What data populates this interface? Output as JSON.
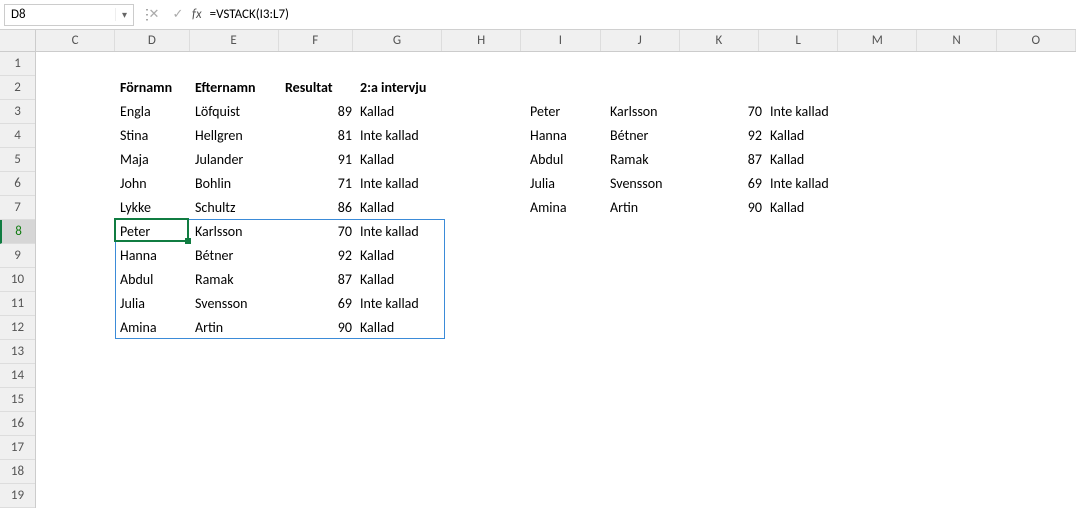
{
  "nameBox": "D8",
  "formula": "=VSTACK(I3:L7)",
  "colWidths": {
    "C": 80,
    "D": 75,
    "E": 90,
    "F": 75,
    "G": 90,
    "H": 80,
    "I": 80,
    "J": 80,
    "K": 80,
    "L": 80,
    "M": 80,
    "N": 80,
    "O": 80
  },
  "columns": [
    "C",
    "D",
    "E",
    "F",
    "G",
    "H",
    "I",
    "J",
    "K",
    "L",
    "M",
    "N",
    "O"
  ],
  "rowCount": 19,
  "activeCell": {
    "col": "D",
    "row": 8
  },
  "spillRange": {
    "col1": "D",
    "row1": 8,
    "col2": "G",
    "row2": 12
  },
  "headers": {
    "D2": "Förnamn",
    "E2": "Efternamn",
    "F2": "Resultat",
    "G2": "2:a intervju"
  },
  "leftTable": [
    {
      "fn": "Engla",
      "efternamn": "Löfquist",
      "resultat": 89,
      "intervju": "Kallad"
    },
    {
      "fn": "Stina",
      "efternamn": "Hellgren",
      "resultat": 81,
      "intervju": "Inte kallad"
    },
    {
      "fn": "Maja",
      "efternamn": "Julander",
      "resultat": 91,
      "intervju": "Kallad"
    },
    {
      "fn": "John",
      "efternamn": "Bohlin",
      "resultat": 71,
      "intervju": "Inte kallad"
    },
    {
      "fn": "Lykke",
      "efternamn": "Schultz",
      "resultat": 86,
      "intervju": "Kallad"
    },
    {
      "fn": "Peter",
      "efternamn": "Karlsson",
      "resultat": 70,
      "intervju": "Inte kallad"
    },
    {
      "fn": "Hanna",
      "efternamn": "Bétner",
      "resultat": 92,
      "intervju": "Kallad"
    },
    {
      "fn": "Abdul",
      "efternamn": "Ramak",
      "resultat": 87,
      "intervju": "Kallad"
    },
    {
      "fn": "Julia",
      "efternamn": "Svensson",
      "resultat": 69,
      "intervju": "Inte kallad"
    },
    {
      "fn": "Amina",
      "efternamn": "Artin",
      "resultat": 90,
      "intervju": "Kallad"
    }
  ],
  "rightTable": [
    {
      "fn": "Peter",
      "efternamn": "Karlsson",
      "resultat": 70,
      "intervju": "Inte kallad"
    },
    {
      "fn": "Hanna",
      "efternamn": "Bétner",
      "resultat": 92,
      "intervju": "Kallad"
    },
    {
      "fn": "Abdul",
      "efternamn": "Ramak",
      "resultat": 87,
      "intervju": "Kallad"
    },
    {
      "fn": "Julia",
      "efternamn": "Svensson",
      "resultat": 69,
      "intervju": "Inte kallad"
    },
    {
      "fn": "Amina",
      "efternamn": "Artin",
      "resultat": 90,
      "intervju": "Kallad"
    }
  ]
}
